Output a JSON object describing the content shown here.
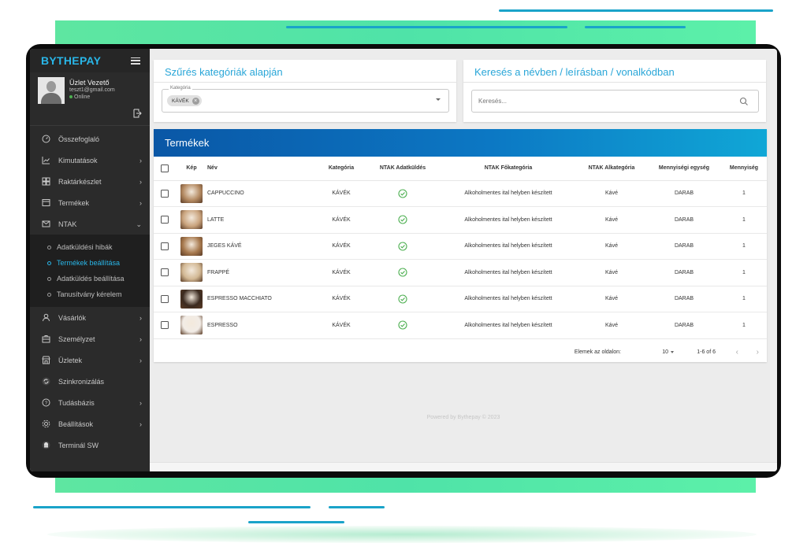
{
  "brand": "BYTHEPAY",
  "user": {
    "name": "Üzlet Vezető",
    "email": "teszt1@gmail.com",
    "status": "Online"
  },
  "nav": {
    "overview": "Összefoglaló",
    "reports": "Kimutatások",
    "inventory": "Raktárkészlet",
    "products": "Termékek",
    "ntak": "NTAK",
    "ntak_sub": [
      "Adatküldési hibák",
      "Termékek beállítása",
      "Adatküldés beállítása",
      "Tanusítvány kérelem"
    ],
    "customers": "Vásárlók",
    "staff": "Személyzet",
    "stores": "Üzletek",
    "sync": "Szinkronizálás",
    "knowledge": "Tudásbázis",
    "settings": "Beállítások",
    "terminal": "Terminál SW"
  },
  "filter": {
    "title": "Szűrés kategóriák alapján",
    "field_label": "Kategória",
    "chip": "KÁVÉK"
  },
  "search": {
    "title": "Keresés a névben / leírásban / vonalkódban",
    "placeholder": "Keresés..."
  },
  "products": {
    "title": "Termékek",
    "columns": [
      "Kép",
      "Név",
      "Kategória",
      "NTAK Adatküldés",
      "NTAK Főkategória",
      "NTAK Alkategória",
      "Mennyiségi egység",
      "Mennyiség"
    ],
    "rows": [
      {
        "name": "CAPPUCCINO",
        "category": "KÁVÉK",
        "main_cat": "Alkoholmentes ital helyben készített",
        "sub_cat": "Kávé",
        "unit": "DARAB",
        "qty": "1",
        "thumb": "#b48a62"
      },
      {
        "name": "LATTE",
        "category": "KÁVÉK",
        "main_cat": "Alkoholmentes ital helyben készített",
        "sub_cat": "Kávé",
        "unit": "DARAB",
        "qty": "1",
        "thumb": "#c9a37d"
      },
      {
        "name": "JEGES KÁVÉ",
        "category": "KÁVÉK",
        "main_cat": "Alkoholmentes ital helyben készített",
        "sub_cat": "Kávé",
        "unit": "DARAB",
        "qty": "1",
        "thumb": "#a7794e"
      },
      {
        "name": "FRAPPÉ",
        "category": "KÁVÉK",
        "main_cat": "Alkoholmentes ital helyben készített",
        "sub_cat": "Kávé",
        "unit": "DARAB",
        "qty": "1",
        "thumb": "#d2b894"
      },
      {
        "name": "ESPRESSO MACCHIATO",
        "category": "KÁVÉK",
        "main_cat": "Alkoholmentes ital helyben készített",
        "sub_cat": "Kávé",
        "unit": "DARAB",
        "qty": "1",
        "thumb": "#3b2a1f"
      },
      {
        "name": "ESPRESSO",
        "category": "KÁVÉK",
        "main_cat": "Alkoholmentes ital helyben készített",
        "sub_cat": "Kávé",
        "unit": "DARAB",
        "qty": "1",
        "thumb": "#f2ece6"
      }
    ]
  },
  "pager": {
    "label": "Elemek az oldalon:",
    "per_page": "10",
    "range": "1-6 of 6",
    "prev": "‹",
    "next": "›"
  },
  "footer": "Powered by Bythepay © 2023",
  "colors": {
    "accent": "#29b6e8",
    "sidebar": "#2b2b2b",
    "header_from": "#0a57a6",
    "header_to": "#10a7d6",
    "ok": "#4caf50"
  }
}
